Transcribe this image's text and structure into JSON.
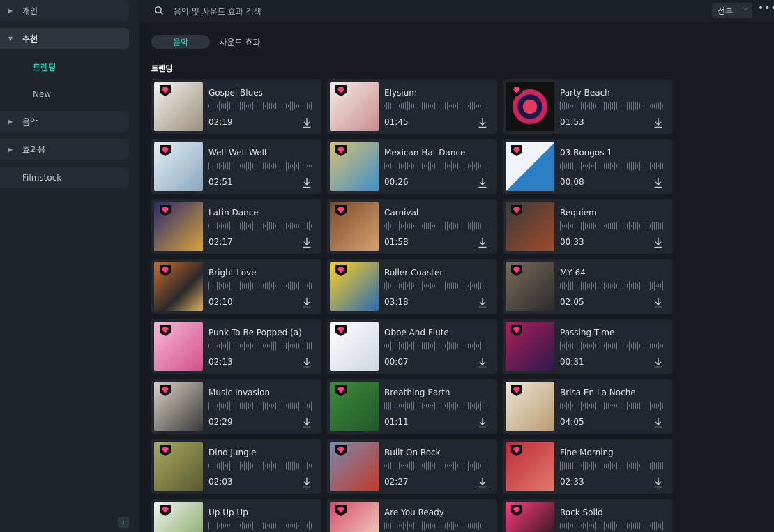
{
  "sidebar": {
    "items": [
      {
        "label": "개인"
      },
      {
        "label": "추천"
      },
      {
        "label": "음악"
      },
      {
        "label": "효과음"
      },
      {
        "label": "Filmstock"
      }
    ],
    "sub_items": [
      {
        "label": "트렌딩"
      },
      {
        "label": "New"
      }
    ]
  },
  "search": {
    "placeholder": "음악 및 사운드 효과 검색"
  },
  "filter": {
    "selected": "전부"
  },
  "tabs": [
    {
      "label": "음악"
    },
    {
      "label": "사운드 효과"
    }
  ],
  "section_title": "트렌딩",
  "accent_color": "#27d3b5",
  "tracks": [
    {
      "title": "Gospel Blues",
      "duration": "02:19"
    },
    {
      "title": "Elysium",
      "duration": "01:45"
    },
    {
      "title": "Party Beach",
      "duration": "01:53"
    },
    {
      "title": "Well Well Well",
      "duration": "02:51"
    },
    {
      "title": "Mexican Hat Dance",
      "duration": "00:26"
    },
    {
      "title": "03.Bongos 1",
      "duration": "00:08"
    },
    {
      "title": "Latin Dance",
      "duration": "02:17"
    },
    {
      "title": "Carnival",
      "duration": "01:58"
    },
    {
      "title": "Requiem",
      "duration": "00:33"
    },
    {
      "title": "Bright Love",
      "duration": "02:10"
    },
    {
      "title": "Roller Coaster",
      "duration": "03:18"
    },
    {
      "title": "MY 64",
      "duration": "02:05"
    },
    {
      "title": "Punk To Be Popped (a)",
      "duration": "02:13"
    },
    {
      "title": "Oboe And Flute",
      "duration": "00:07"
    },
    {
      "title": "Passing Time",
      "duration": "00:31"
    },
    {
      "title": "Music Invasion",
      "duration": "02:29"
    },
    {
      "title": "Breathing Earth",
      "duration": "01:11"
    },
    {
      "title": "Brisa En La Noche",
      "duration": "04:05"
    },
    {
      "title": "Dino Jungle",
      "duration": "02:03"
    },
    {
      "title": "Built On Rock",
      "duration": "02:27"
    },
    {
      "title": "Fine Morning",
      "duration": "02:33"
    },
    {
      "title": "Up Up Up",
      "duration": ""
    },
    {
      "title": "Are You Ready",
      "duration": ""
    },
    {
      "title": "Rock Solid",
      "duration": ""
    }
  ]
}
